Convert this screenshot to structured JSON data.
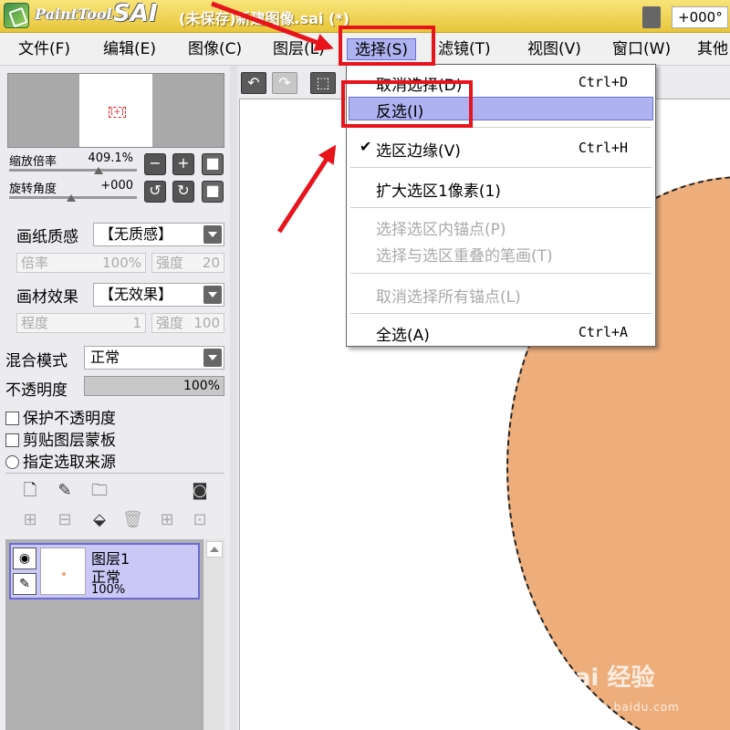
{
  "titlebar": {
    "brand_small": "PaintTool",
    "brand_large": "SAI",
    "doc_title": "(未保存)新建图像.sai (*)"
  },
  "menubar": {
    "items": [
      {
        "label": "文件(F)"
      },
      {
        "label": "编辑(E)"
      },
      {
        "label": "图像(C)"
      },
      {
        "label": "图层(L)"
      },
      {
        "label": "选择(S)"
      },
      {
        "label": "滤镜(T)"
      },
      {
        "label": "视图(V)"
      },
      {
        "label": "窗口(W)"
      },
      {
        "label": "其他"
      }
    ]
  },
  "navigator": {
    "zoom_label": "缩放倍率",
    "zoom_value": "409.1%",
    "rotate_label": "旋转角度",
    "rotate_value": "+000"
  },
  "paper": {
    "label": "画纸质感",
    "value": "【无质感】",
    "scale_label": "倍率",
    "scale_value": "100%",
    "strength_label": "强度",
    "strength_value": "20"
  },
  "material": {
    "label": "画材效果",
    "value": "【无效果】",
    "degree_label": "程度",
    "degree_value": "1",
    "strength_label": "强度",
    "strength_value": "100"
  },
  "blend": {
    "label": "混合模式",
    "value": "正常"
  },
  "opacity": {
    "label": "不透明度",
    "value": "100%",
    "fill_fraction": 1.0
  },
  "checks": {
    "protect": "保护不透明度",
    "clip": "剪贴图层蒙板",
    "source": "指定选取来源"
  },
  "layer": {
    "name": "图层1",
    "mode": "正常",
    "opacity": "100%"
  },
  "canvas_toolbar": {
    "angle": "+000°"
  },
  "select_menu": {
    "deselect": "取消选择(D)",
    "deselect_shortcut": "Ctrl+D",
    "invert": "反选(I)",
    "edge": "选区边缘(V)",
    "edge_shortcut": "Ctrl+H",
    "expand": "扩大选区1像素(1)",
    "select_anchors": "选择选区内锚点(P)",
    "select_strokes": "选择与选区重叠的笔画(T)",
    "deselect_anchors": "取消选择所有锚点(L)",
    "select_all": "全选(A)",
    "select_all_shortcut": "Ctrl+A"
  },
  "watermark": {
    "text": "Bai 经验",
    "sub": "jingyan.baidu.com"
  },
  "colors": {
    "accent": "#aeb2f0",
    "shape": "#edae7c",
    "annotation": "#e8141c"
  }
}
